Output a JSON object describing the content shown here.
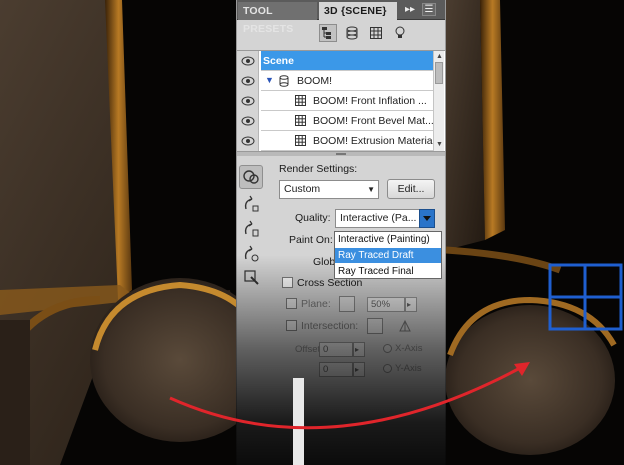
{
  "tabs": {
    "tool_presets": "TOOL PRESETS",
    "scene_3d": "3D {SCENE}"
  },
  "toolbar": {
    "icons": [
      "scene-filter-icon",
      "meshes-filter-icon",
      "materials-filter-icon",
      "lights-filter-icon"
    ]
  },
  "layers": [
    {
      "label": "Scene",
      "selected": true
    },
    {
      "label": "BOOM!",
      "selected": false
    },
    {
      "label": "BOOM! Front Inflation ...",
      "selected": false
    },
    {
      "label": "BOOM! Front Bevel Mat...",
      "selected": false
    },
    {
      "label": "BOOM! Extrusion Material",
      "selected": false
    }
  ],
  "settings": {
    "render_settings_label": "Render Settings:",
    "render_preset_value": "Custom",
    "edit_button": "Edit...",
    "quality_label": "Quality:",
    "quality_value": "Interactive (Pa...",
    "paint_on_label": "Paint On:",
    "global_label": "Global A",
    "cross_section_label": "Cross Section",
    "plane_label": "Plane:",
    "plane_opacity": "50%",
    "intersection_label": "Intersection:",
    "offset_label": "Offset:",
    "offset_value": "0",
    "tilt_value": "0",
    "x_axis_label": "X-Axis",
    "y_axis_label": "Y-Axis"
  },
  "dropdown_options": [
    "Interactive (Painting)",
    "Ray Traced Draft",
    "Ray Traced Final"
  ],
  "dropdown_highlighted": "Ray Traced Draft",
  "colors": {
    "selection_blue": "#3b98e8",
    "arrow_red": "#e0252b",
    "icon_blue": "#1f5fd0"
  },
  "overlay_icon": "four-pane-window-icon"
}
